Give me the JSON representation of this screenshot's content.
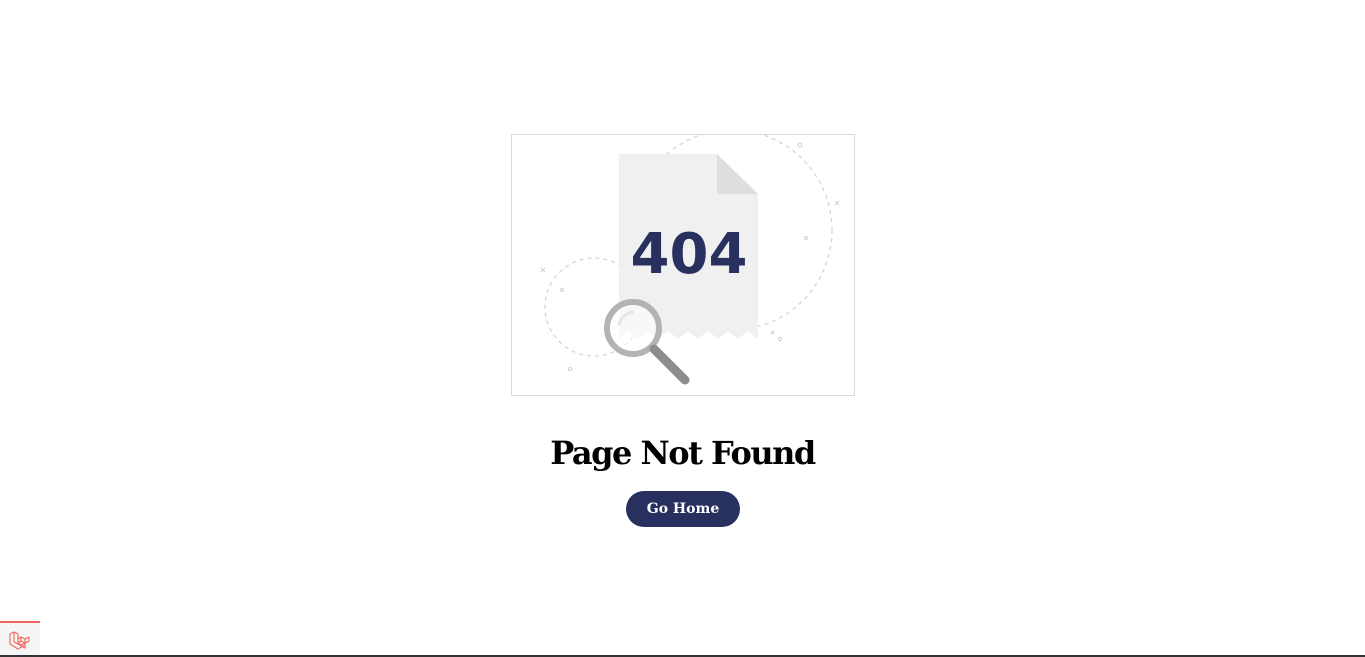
{
  "illustration": {
    "code": "404",
    "icons": [
      "document-icon",
      "magnifying-glass-icon"
    ],
    "colors": {
      "code_text": "#27305e",
      "paper": "#f0f0f0",
      "paper_fold": "#dedede",
      "magnifier": "#b3b3b3",
      "handle": "#8c8c8c"
    }
  },
  "page": {
    "title": "Page Not Found",
    "button_label": "Go Home",
    "accent_color": "#27305e"
  },
  "debugbar": {
    "icon": "laravel-logo-icon",
    "accent_color": "#f4645f"
  }
}
